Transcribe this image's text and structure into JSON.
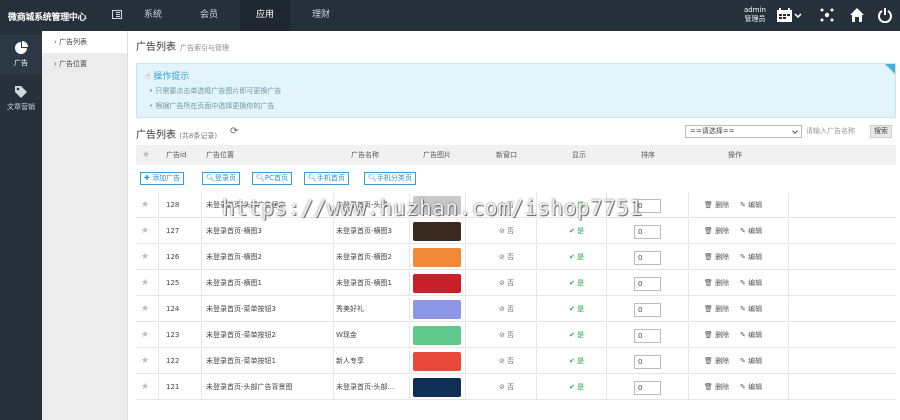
{
  "topbar": {
    "brand": "微商城系统管理中心",
    "nav": [
      "系统",
      "会员",
      "应用",
      "理财"
    ],
    "active_nav": "应用",
    "admin_name": "admin",
    "admin_role": "管理员"
  },
  "sidebar": {
    "items": [
      {
        "label": "广告",
        "icon": "pie-chart-icon"
      },
      {
        "label": "文章营销",
        "icon": "tag-icon"
      }
    ]
  },
  "subnav": {
    "items": [
      "广告列表",
      "广告位置"
    ]
  },
  "page": {
    "title": "广告列表",
    "subtitle": "广告索引与管理"
  },
  "tips": {
    "title": "操作提示",
    "lines": [
      "只需要点击单选框广告图片即可更换广告",
      "根据广告所在页面中选择更换你的广告"
    ]
  },
  "list": {
    "title": "广告列表",
    "count_text": "(共8条记录)",
    "select_value": "==请选择==",
    "search_placeholder": "请输入广告名称",
    "search_button": "搜索"
  },
  "table": {
    "headers": [
      "广告id",
      "广告位置",
      "广告名称",
      "广告图片",
      "新窗口",
      "显示",
      "排序",
      "操作"
    ],
    "toolbar_buttons": [
      "添加广告",
      "登录页",
      "PC首页",
      "手机首页",
      "手机分类页"
    ],
    "no_label": "否",
    "yes_label": "是",
    "delete_label": "删除",
    "edit_label": "编辑",
    "rows": [
      {
        "id": "128",
        "position": "未登录首页-头部广告居中",
        "name": "未登录首页-头部",
        "image_color": "#c9c9c9",
        "sort": "0"
      },
      {
        "id": "127",
        "position": "未登录首页-横图3",
        "name": "未登录首页-横图3",
        "image_color": "#3a2a22",
        "sort": "0"
      },
      {
        "id": "126",
        "position": "未登录首页-横图2",
        "name": "未登录首页-横图2",
        "image_color": "#f08a3a",
        "sort": "0"
      },
      {
        "id": "125",
        "position": "未登录首页-横图1",
        "name": "未登录首页-横图1",
        "image_color": "#c8202a",
        "sort": "0"
      },
      {
        "id": "124",
        "position": "未登录首页-菜单按钮3",
        "name": "秀美好礼",
        "image_color": "#8e96e8",
        "sort": "0"
      },
      {
        "id": "123",
        "position": "未登录首页-菜单按钮2",
        "name": "W现金",
        "image_color": "#5fc98b",
        "sort": "0"
      },
      {
        "id": "122",
        "position": "未登录首页-菜单按钮1",
        "name": "新人专享",
        "image_color": "#e8493a",
        "sort": "0"
      },
      {
        "id": "121",
        "position": "未登录首页-头部广告背景图",
        "name": "未登录首页-头部...",
        "image_color": "#0e2e56",
        "sort": "0"
      }
    ]
  },
  "watermark": "https://www.huzhan.com/ishop7751"
}
